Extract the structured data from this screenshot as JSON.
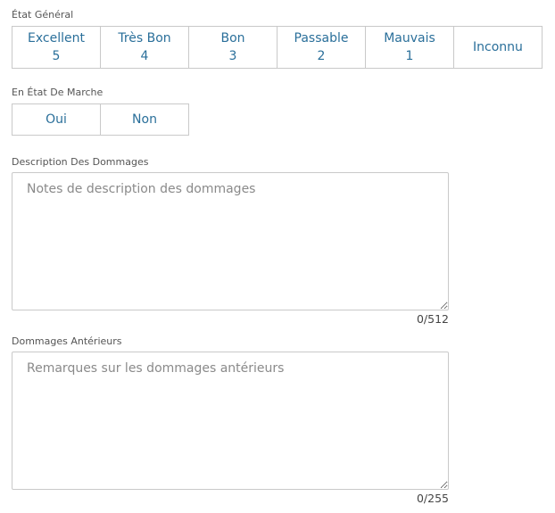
{
  "etat_general": {
    "label": "État Général",
    "options": [
      {
        "label": "Excellent",
        "score": "5"
      },
      {
        "label": "Très Bon",
        "score": "4"
      },
      {
        "label": "Bon",
        "score": "3"
      },
      {
        "label": "Passable",
        "score": "2"
      },
      {
        "label": "Mauvais",
        "score": "1"
      },
      {
        "label": "Inconnu",
        "score": ""
      }
    ]
  },
  "en_etat_de_marche": {
    "label": "En État De Marche",
    "options": [
      {
        "label": "Oui"
      },
      {
        "label": "Non"
      }
    ]
  },
  "description_dommages": {
    "label": "Description Des Dommages",
    "placeholder": "Notes de description des dommages",
    "value": "",
    "counter": "0/512"
  },
  "dommages_anterieurs": {
    "label": "Dommages Antérieurs",
    "placeholder": "Remarques sur les dommages antérieurs",
    "value": "",
    "counter": "0/255"
  },
  "colors": {
    "button_text": "#2a6f9a",
    "border": "#c9c9c9",
    "placeholder": "#8a8a8a"
  }
}
